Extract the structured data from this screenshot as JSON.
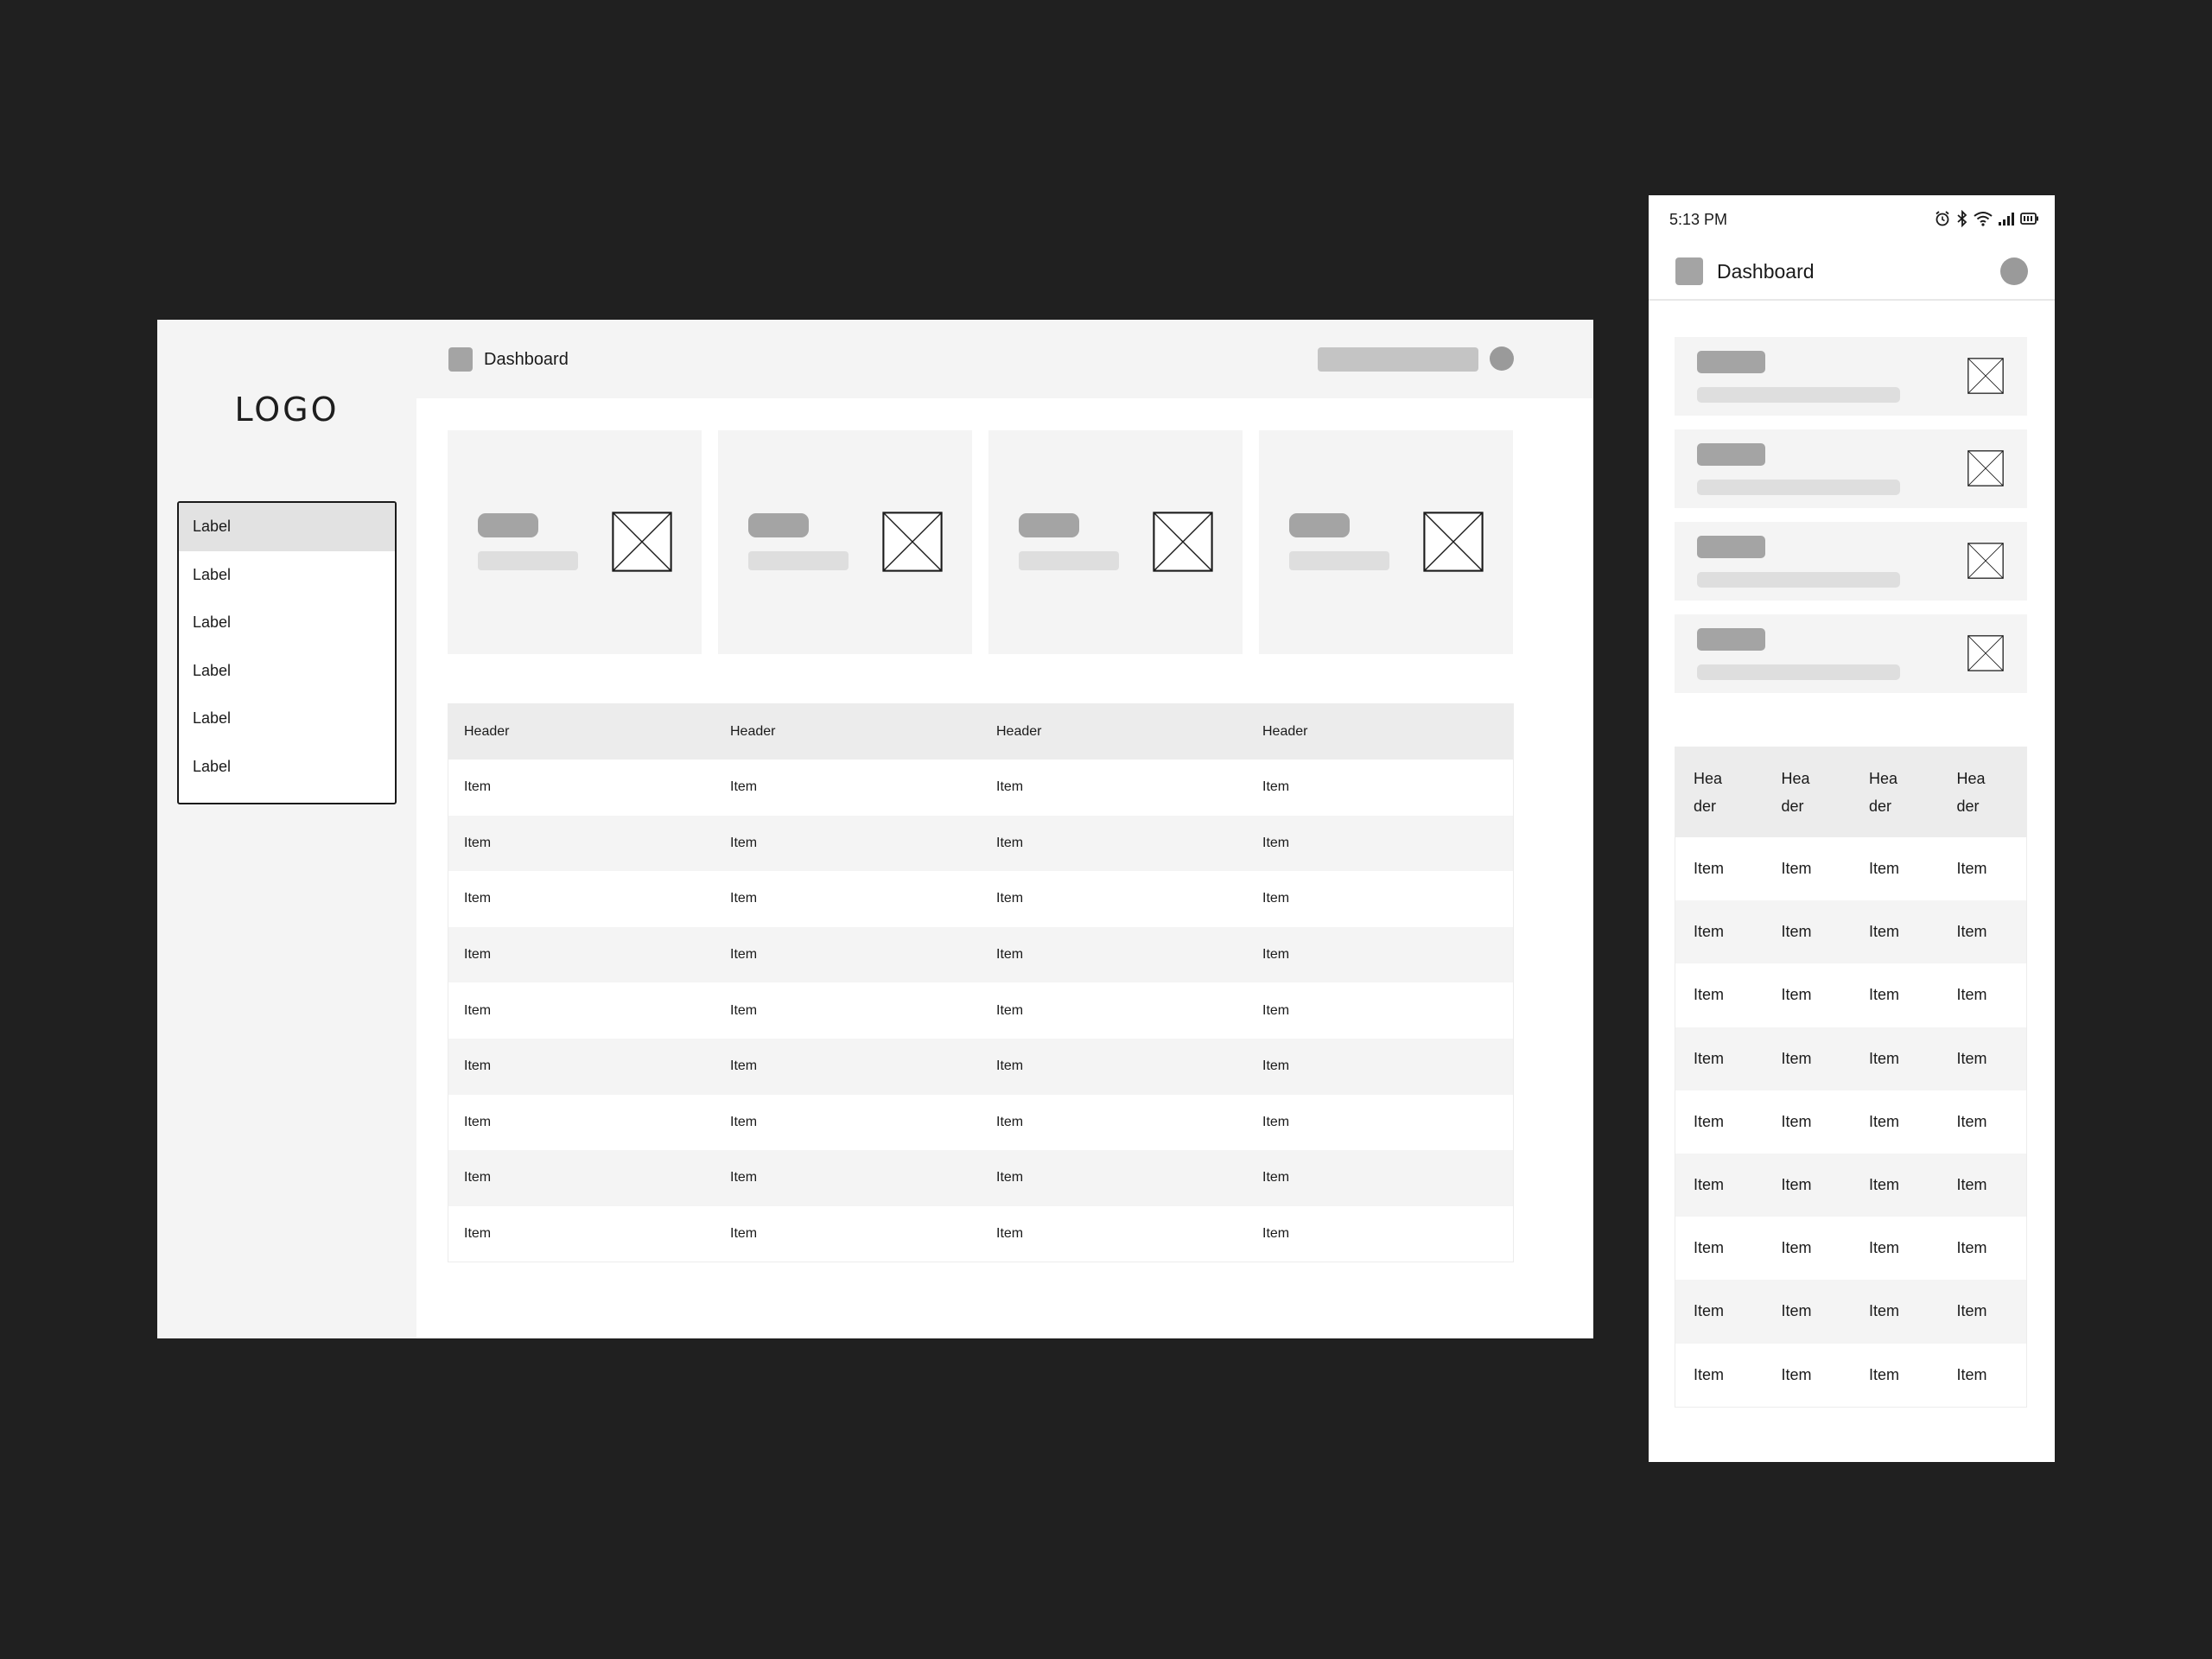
{
  "desktop": {
    "logo": "LOGO",
    "nav_items": [
      "Label",
      "Label",
      "Label",
      "Label",
      "Label",
      "Label"
    ],
    "active_nav_index": 0,
    "topbar": {
      "title": "Dashboard"
    },
    "cards": 4,
    "table": {
      "headers": [
        "Header",
        "Header",
        "Header",
        "Header"
      ],
      "rows": [
        [
          "Item",
          "Item",
          "Item",
          "Item"
        ],
        [
          "Item",
          "Item",
          "Item",
          "Item"
        ],
        [
          "Item",
          "Item",
          "Item",
          "Item"
        ],
        [
          "Item",
          "Item",
          "Item",
          "Item"
        ],
        [
          "Item",
          "Item",
          "Item",
          "Item"
        ],
        [
          "Item",
          "Item",
          "Item",
          "Item"
        ],
        [
          "Item",
          "Item",
          "Item",
          "Item"
        ],
        [
          "Item",
          "Item",
          "Item",
          "Item"
        ],
        [
          "Item",
          "Item",
          "Item",
          "Item"
        ]
      ]
    }
  },
  "mobile": {
    "status_bar": {
      "time": "5:13 PM",
      "icons": [
        "alarm-icon",
        "bluetooth-icon",
        "wifi-icon",
        "signal-icon",
        "battery-icon"
      ]
    },
    "appbar": {
      "title": "Dashboard"
    },
    "cards": 4,
    "table": {
      "headers": [
        "Header",
        "Header",
        "Header",
        "Header"
      ],
      "rows": [
        [
          "Item",
          "Item",
          "Item",
          "Item"
        ],
        [
          "Item",
          "Item",
          "Item",
          "Item"
        ],
        [
          "Item",
          "Item",
          "Item",
          "Item"
        ],
        [
          "Item",
          "Item",
          "Item",
          "Item"
        ],
        [
          "Item",
          "Item",
          "Item",
          "Item"
        ],
        [
          "Item",
          "Item",
          "Item",
          "Item"
        ],
        [
          "Item",
          "Item",
          "Item",
          "Item"
        ],
        [
          "Item",
          "Item",
          "Item",
          "Item"
        ],
        [
          "Item",
          "Item",
          "Item",
          "Item"
        ]
      ]
    }
  },
  "colors": {
    "background": "#202020",
    "panel": "#f4f4f4",
    "placeholder_dark": "#a4a4a4",
    "placeholder_light": "#dedede",
    "table_header": "#ececec"
  }
}
